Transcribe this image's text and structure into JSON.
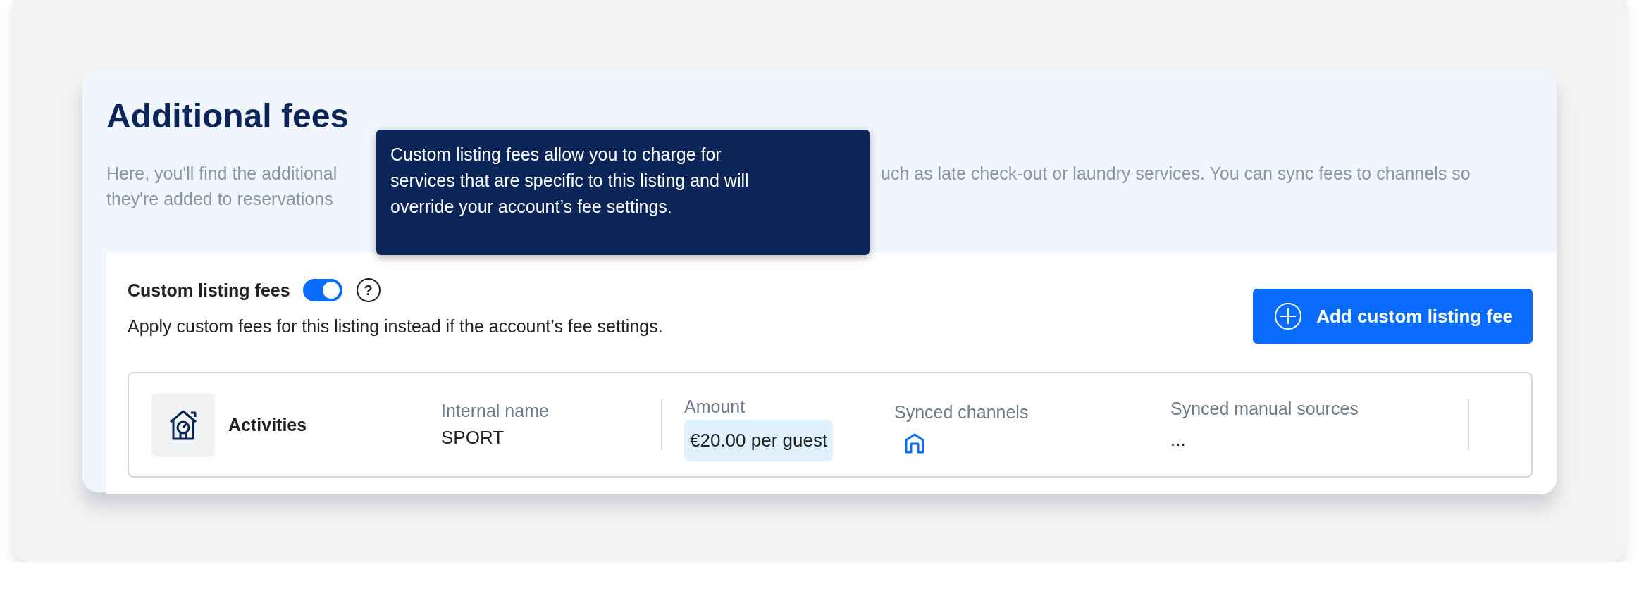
{
  "title": "Additional fees",
  "description": {
    "line_1_start": "Here, you'll find the additional",
    "line_1_end": "uch as late check-out or laundry services. You can sync fees to channels so",
    "line_2_start": "they're added to reservations"
  },
  "tooltip": {
    "lines": [
      "Custom listing fees allow you to charge for",
      "services that are specific to this listing and will",
      "override your account’s fee settings."
    ]
  },
  "custom_fees": {
    "label": "Custom listing fees",
    "on": true,
    "help": "?",
    "subtitle": "Apply custom fees for this listing instead if the account’s fee settings."
  },
  "add_button": {
    "label": "Add custom listing fee"
  },
  "fees": [
    {
      "name": "Activities",
      "internal_name_label": "Internal name",
      "internal_name": "SPORT",
      "amount_label": "Amount",
      "amount": "€20.00 per guest",
      "channels_label": "Synced channels",
      "manual_sources_label": "Synced manual sources",
      "manual_sources": "..."
    }
  ]
}
